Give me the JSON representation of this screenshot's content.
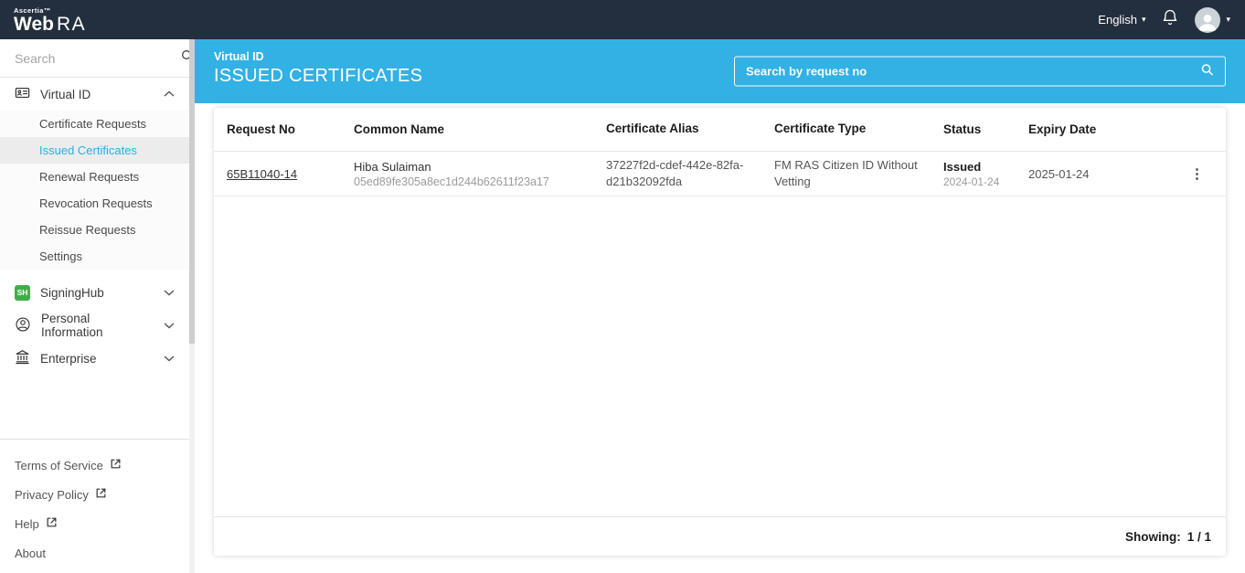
{
  "header": {
    "brand_top": "Ascertia™",
    "brand_bold": "Web",
    "brand_light": "RA",
    "language_label": "English",
    "caret_glyph": "▾"
  },
  "sidebar": {
    "search_placeholder": "Search",
    "virtual_id": {
      "label": "Virtual ID",
      "items": [
        "Certificate Requests",
        "Issued Certificates",
        "Renewal Requests",
        "Revocation Requests",
        "Reissue Requests",
        "Settings"
      ],
      "active_item": "Issued Certificates"
    },
    "signinghub_label": "SigningHub",
    "signinghub_badge": "SH",
    "personal_info_label": "Personal Information",
    "enterprise_label": "Enterprise",
    "footer_links": [
      "Terms of Service",
      "Privacy Policy",
      "Help",
      "About"
    ]
  },
  "main": {
    "banner": {
      "breadcrumb": "Virtual ID",
      "title": "ISSUED CERTIFICATES",
      "search_placeholder": "Search by request no"
    },
    "table": {
      "columns": [
        "Request No",
        "Common Name",
        "Certificate Alias",
        "Certificate Type",
        "Status",
        "Expiry Date"
      ],
      "rows": [
        {
          "request_no": "65B11040-14",
          "common_name": "Hiba Sulaiman",
          "common_name_sub": "05ed89fe305a8ec1d244b62611f23a17",
          "certificate_alias": "37227f2d-cdef-442e-82fa-d21b32092fda",
          "certificate_type": "FM RAS Citizen ID Without Vetting",
          "status": "Issued",
          "status_date": "2024-01-24",
          "expiry_date": "2025-01-24"
        }
      ],
      "kebab_glyph": "⋮"
    },
    "footer": {
      "showing_label": "Showing:",
      "showing_value": "1 / 1"
    }
  },
  "icons": {
    "search": "magnifier",
    "bell": "notification-bell",
    "avatar": "user-silhouette",
    "virtual_id": "id-card",
    "personal_info": "person-circle",
    "enterprise": "bank",
    "external_link": "arrow-out-of-box",
    "kebab": "vertical-ellipsis"
  },
  "colors": {
    "header_bg": "#232f3e",
    "accent": "#32b1e4",
    "active_link": "#2aade0",
    "signinghub_green": "#3fae49"
  }
}
